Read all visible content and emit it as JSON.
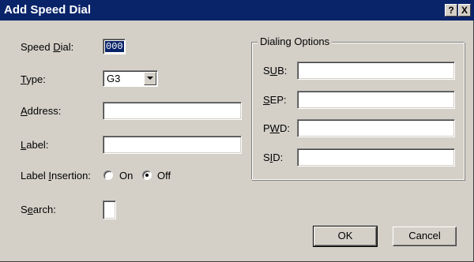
{
  "window": {
    "title": "Add Speed Dial",
    "help_label": "?",
    "close_label": "X"
  },
  "form": {
    "speed_dial": {
      "label_pre": "Speed ",
      "label_key": "D",
      "label_post": "ial:",
      "value": "000"
    },
    "type": {
      "label_pre": "",
      "label_key": "T",
      "label_post": "ype:",
      "value": "G3"
    },
    "address": {
      "label_pre": "",
      "label_key": "A",
      "label_post": "ddress:",
      "value": ""
    },
    "label": {
      "label_pre": "",
      "label_key": "L",
      "label_post": "abel:",
      "value": ""
    },
    "label_insertion": {
      "label_pre": "Label ",
      "label_key": "I",
      "label_post": "nsertion:",
      "options": [
        "On",
        "Off"
      ],
      "selected": "Off"
    },
    "search": {
      "label_pre": "S",
      "label_key": "e",
      "label_post": "arch:",
      "checked": false
    }
  },
  "dialing_options": {
    "title": "Dialing Options",
    "fields": [
      {
        "pre": "S",
        "key": "U",
        "post": "B:",
        "value": ""
      },
      {
        "pre": "",
        "key": "S",
        "post": "EP:",
        "value": ""
      },
      {
        "pre": "P",
        "key": "W",
        "post": "D:",
        "value": ""
      },
      {
        "pre": "S",
        "key": "I",
        "post": "D:",
        "value": ""
      }
    ]
  },
  "buttons": {
    "ok": "OK",
    "cancel": "Cancel"
  },
  "colors": {
    "titlebar": "#0a246a",
    "face": "#d4d0c8",
    "selection": "#0a246a"
  }
}
